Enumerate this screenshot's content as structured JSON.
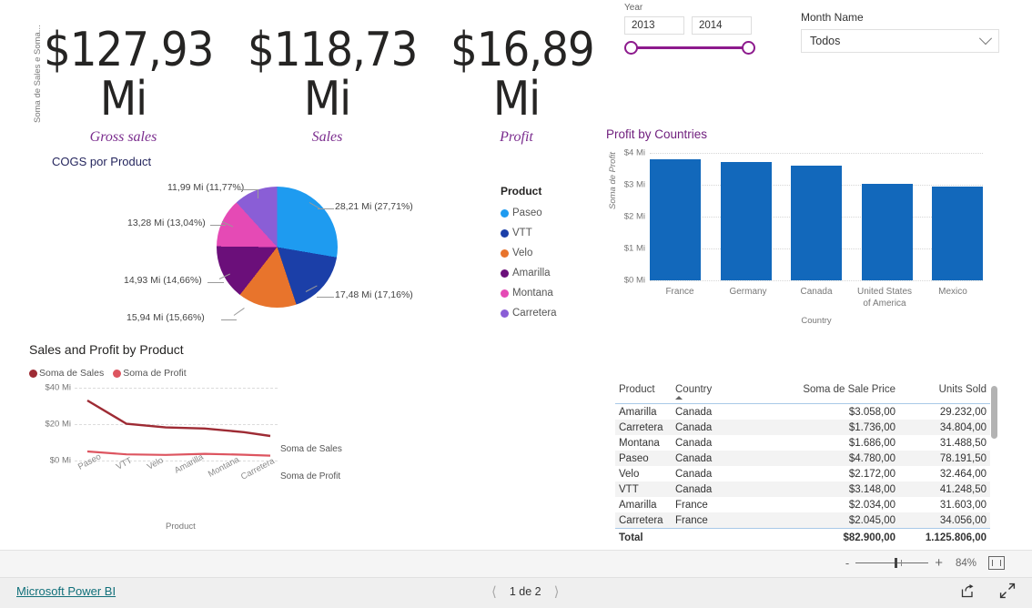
{
  "kpis": [
    {
      "value": "$127,93 Mi",
      "caption": "Gross sales"
    },
    {
      "value": "$118,73 Mi",
      "caption": "Sales"
    },
    {
      "value": "$16,89 Mi",
      "caption": "Profit"
    }
  ],
  "pie_title": "COGS por Product",
  "legend": {
    "title": "Product",
    "items": [
      {
        "label": "Paseo",
        "color": "#1e9bf0"
      },
      {
        "label": "VTT",
        "color": "#1b3fa8"
      },
      {
        "label": "Velo",
        "color": "#e8742c"
      },
      {
        "label": "Amarilla",
        "color": "#6b0f7a"
      },
      {
        "label": "Montana",
        "color": "#e54ab5"
      },
      {
        "label": "Carretera",
        "color": "#8a5ed6"
      }
    ]
  },
  "year_slicer": {
    "label": "Year",
    "start": "2013",
    "end": "2014"
  },
  "month_slicer": {
    "label": "Month Name",
    "value": "Todos"
  },
  "table": {
    "headers": [
      "Product",
      "Country",
      "Soma de Sale Price",
      "Units Sold"
    ],
    "rows": [
      [
        "Amarilla",
        "Canada",
        "$3.058,00",
        "29.232,00"
      ],
      [
        "Carretera",
        "Canada",
        "$1.736,00",
        "34.804,00"
      ],
      [
        "Montana",
        "Canada",
        "$1.686,00",
        "31.488,50"
      ],
      [
        "Paseo",
        "Canada",
        "$4.780,00",
        "78.191,50"
      ],
      [
        "Velo",
        "Canada",
        "$2.172,00",
        "32.464,00"
      ],
      [
        "VTT",
        "Canada",
        "$3.148,00",
        "41.248,50"
      ],
      [
        "Amarilla",
        "France",
        "$2.034,00",
        "31.603,00"
      ],
      [
        "Carretera",
        "France",
        "$2.045,00",
        "34.056,00"
      ]
    ],
    "total_label": "Total",
    "total_price": "$82.900,00",
    "total_units": "1.125.806,00"
  },
  "footer": {
    "brand": "Microsoft Power BI",
    "page": "1 de 2",
    "zoom": "84%",
    "minus": "-",
    "plus": "+"
  },
  "chart_data": [
    {
      "type": "pie",
      "title": "COGS por Product",
      "legend_title": "Product",
      "legend_position": "right",
      "categories": [
        "Paseo",
        "VTT",
        "Velo",
        "Amarilla",
        "Montana",
        "Carretera"
      ],
      "values": [
        28.21,
        17.48,
        15.94,
        14.93,
        13.28,
        11.99
      ],
      "percents": [
        27.71,
        17.16,
        15.66,
        14.66,
        13.04,
        11.77
      ],
      "labels": [
        "28,21 Mi (27,71%)",
        "17,48 Mi (17,16%)",
        "15,94 Mi (15,66%)",
        "14,93 Mi (14,66%)",
        "13,28 Mi (13,04%)",
        "11,99 Mi (11,77%)"
      ],
      "colors": [
        "#1e9bf0",
        "#1b3fa8",
        "#e8742c",
        "#6b0f7a",
        "#e54ab5",
        "#8a5ed6"
      ]
    },
    {
      "type": "bar",
      "title": "Profit by Countries",
      "xlabel": "Country",
      "ylabel": "Soma de Profit",
      "categories": [
        "France",
        "Germany",
        "Canada",
        "United States of America",
        "Mexico"
      ],
      "values": [
        3.8,
        3.72,
        3.6,
        3.02,
        2.95
      ],
      "ylim": [
        0,
        4
      ],
      "yticks": [
        "$0 Mi",
        "$1 Mi",
        "$2 Mi",
        "$3 Mi",
        "$4 Mi"
      ],
      "grid": true,
      "color": "#1268bb"
    },
    {
      "type": "line",
      "title": "Sales and Profit by Product",
      "xlabel": "Product",
      "ylabel": "Soma de Sales e Soma...",
      "categories": [
        "Paseo",
        "VTT",
        "Velo",
        "Amarilla",
        "Montana",
        "Carretera"
      ],
      "ylim": [
        0,
        40
      ],
      "yticks": [
        "$0 Mi",
        "$20 Mi",
        "$40 Mi"
      ],
      "grid": true,
      "legend_position": "top",
      "series": [
        {
          "name": "Soma de  Sales",
          "color": "#9e2b34",
          "values": [
            33.0,
            20.2,
            18.2,
            17.6,
            15.6,
            13.5
          ]
        },
        {
          "name": "Soma de Profit",
          "color": "#dd5560",
          "values": [
            5.0,
            3.4,
            3.1,
            3.7,
            3.2,
            2.7
          ]
        }
      ],
      "series_labels": [
        "Soma de  Sales",
        "Soma de Profit"
      ]
    }
  ]
}
